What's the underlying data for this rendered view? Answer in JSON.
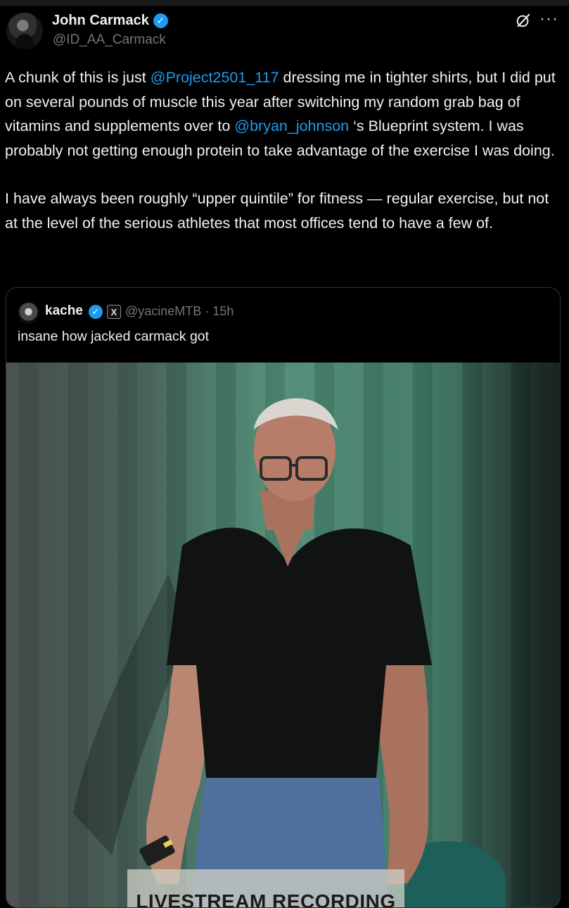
{
  "author": {
    "name": "John Carmack",
    "handle": "@ID_AA_Carmack",
    "verified_icon": "verified-badge-icon"
  },
  "header_actions": {
    "grok_icon": "grok-icon",
    "more_label": "···"
  },
  "tweet": {
    "p1_before": "A chunk of this is just ",
    "mention1": "@Project2501_117",
    "p1_middle": " dressing me in tighter shirts, but I did put on several pounds of muscle this year after switching my random grab bag of vitamins and supplements over to ",
    "mention2": "@bryan_johnson",
    "p1_after": " ‘s Blueprint system. I was probably not getting enough protein to take advantage of the exercise I was doing.",
    "p2": "I have always been roughly “upper quintile” for fitness — regular exercise, but not at the level of the serious athletes that most offices tend to have a few of."
  },
  "quote": {
    "name": "kache",
    "x_badge": "X",
    "meta": "@yacineMTB · 15h",
    "text": "insane how jacked carmack got",
    "media": {
      "banner_text": "LIVESTREAM RECORDING"
    }
  },
  "colors": {
    "link": "#1d9bf0",
    "background": "#000000",
    "muted": "#71767b"
  }
}
